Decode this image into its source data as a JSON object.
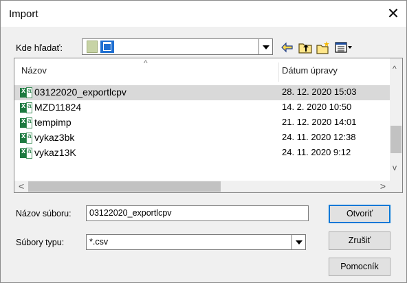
{
  "window": {
    "title": "Import",
    "close_glyph": "✕"
  },
  "lookin": {
    "label": "Kde hľadať:"
  },
  "toolbar": {
    "icons": [
      "back-arrow-icon",
      "up-folder-icon",
      "new-folder-icon",
      "view-menu-icon"
    ]
  },
  "list": {
    "columns": {
      "name": "Názov",
      "date": "Dátum úpravy"
    },
    "sort_glyph": "^",
    "rows": [
      {
        "name": "03122020_exportlcpv",
        "date": "28. 12. 2020 15:03",
        "selected": true
      },
      {
        "name": "MZD11824",
        "date": "14. 2. 2020 10:50",
        "selected": false
      },
      {
        "name": "tempimp",
        "date": "21. 12. 2020 14:01",
        "selected": false
      },
      {
        "name": "vykaz3bk",
        "date": "24. 11. 2020 12:38",
        "selected": false
      },
      {
        "name": "vykaz13K",
        "date": "24. 11. 2020 9:12",
        "selected": false
      }
    ]
  },
  "scroll": {
    "up": "^",
    "down": "v",
    "left": "<",
    "right": ">"
  },
  "filename": {
    "label": "Názov súboru:",
    "value": "03122020_exportlcpv"
  },
  "filetype": {
    "label": "Súbory typu:",
    "value": "*.csv"
  },
  "buttons": {
    "open": "Otvoriť",
    "cancel": "Zrušiť",
    "help": "Pomocník"
  }
}
